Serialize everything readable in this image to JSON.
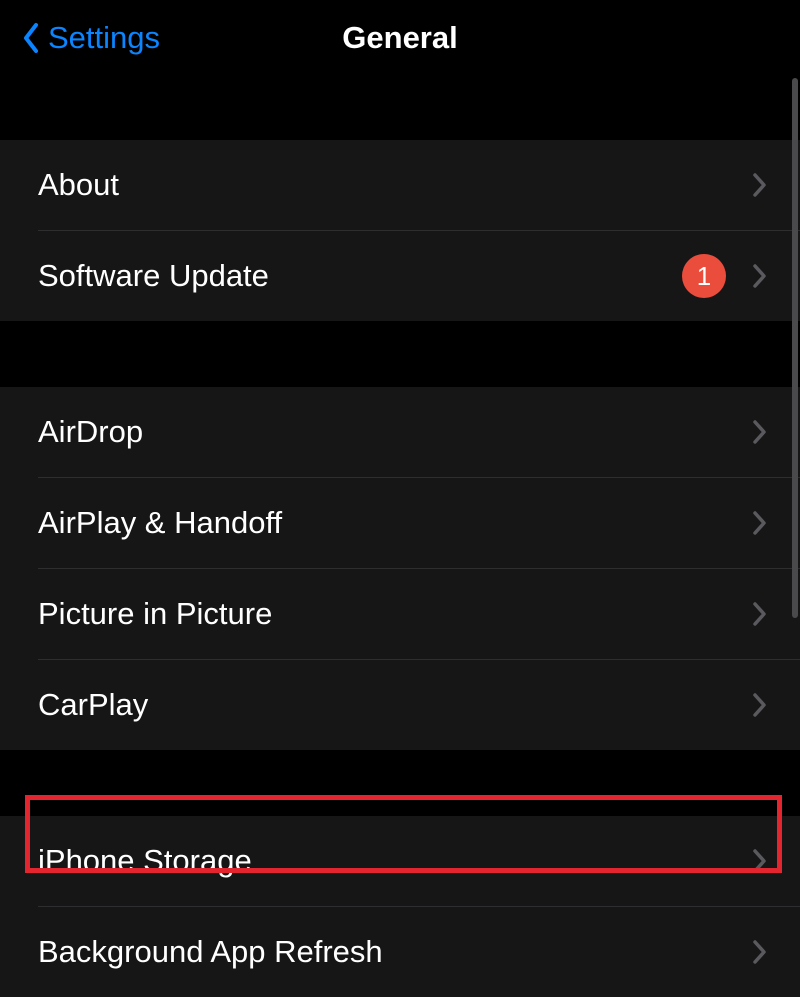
{
  "navbar": {
    "back_label": "Settings",
    "title": "General"
  },
  "sections": [
    {
      "rows": [
        {
          "label": "About",
          "badge": null
        },
        {
          "label": "Software Update",
          "badge": "1"
        }
      ]
    },
    {
      "rows": [
        {
          "label": "AirDrop",
          "badge": null
        },
        {
          "label": "AirPlay & Handoff",
          "badge": null
        },
        {
          "label": "Picture in Picture",
          "badge": null
        },
        {
          "label": "CarPlay",
          "badge": null
        }
      ]
    },
    {
      "rows": [
        {
          "label": "iPhone Storage",
          "badge": null
        },
        {
          "label": "Background App Refresh",
          "badge": null
        }
      ]
    }
  ],
  "colors": {
    "accent": "#0a84ff",
    "badge": "#eb4d3d",
    "highlight": "#e3252f"
  }
}
